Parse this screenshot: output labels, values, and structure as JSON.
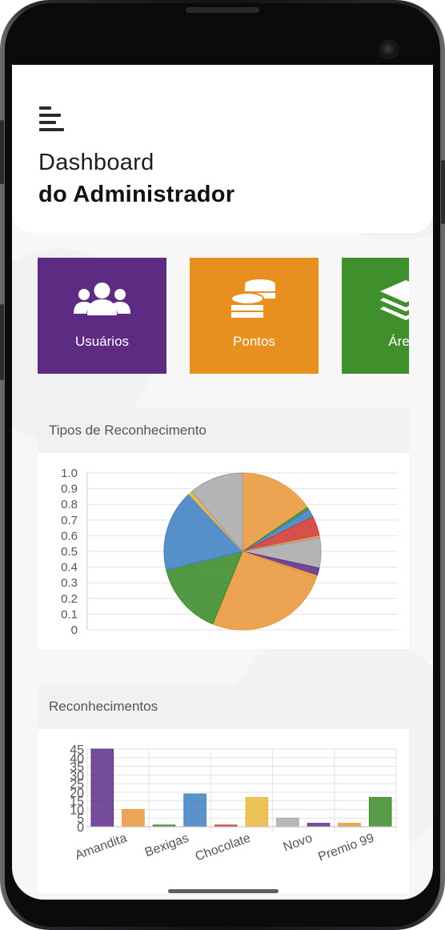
{
  "header": {
    "title_line1": "Dashboard",
    "title_line2": "do Administrador"
  },
  "tiles": [
    {
      "label": "Usuários",
      "icon": "users-icon",
      "color": "#5e2b82"
    },
    {
      "label": "Pontos",
      "icon": "coins-icon",
      "color": "#e8901f"
    },
    {
      "label": "Áreas",
      "icon": "layers-icon",
      "color": "#3f8f2c"
    }
  ],
  "pie_card": {
    "title": "Tipos de Reconhecimento"
  },
  "bar_card": {
    "title": "Reconhecimentos"
  },
  "chart_data": [
    {
      "type": "pie",
      "title": "Tipos de Reconhecimento",
      "y_ticks": [
        "1.0",
        "0.9",
        "0.8",
        "0.7",
        "0.6",
        "0.5",
        "0.4",
        "0.3",
        "0.2",
        "0.1",
        "0"
      ],
      "grid": true,
      "slices": [
        {
          "value": 0.155,
          "color": "#e9973b"
        },
        {
          "value": 0.006,
          "color": "#3b8b2a"
        },
        {
          "value": 0.016,
          "color": "#3f7fc1"
        },
        {
          "value": 0.041,
          "color": "#cf3a33"
        },
        {
          "value": 0.004,
          "color": "#e9973b"
        },
        {
          "value": 0.062,
          "color": "#aaaaaa"
        },
        {
          "value": 0.016,
          "color": "#5e2e86"
        },
        {
          "value": 0.005,
          "color": "#e9973b"
        },
        {
          "value": 0.257,
          "color": "#e9973b"
        },
        {
          "value": 0.15,
          "color": "#3b8b2a"
        },
        {
          "value": 0.168,
          "color": "#3f7fc1"
        },
        {
          "value": 0.008,
          "color": "#e3b33b"
        },
        {
          "value": 0.112,
          "color": "#aaaaaa"
        }
      ]
    },
    {
      "type": "bar",
      "title": "Reconhecimentos",
      "x_tick_labels": [
        "Amandita",
        "Bexigas",
        "Chocolate",
        "Novo",
        "Premio 99"
      ],
      "y_ticks": [
        "45",
        "40",
        "35",
        "30",
        "25",
        "20",
        "15",
        "10",
        "5",
        "0"
      ],
      "ylim": [
        0,
        45
      ],
      "grid": true,
      "values": [
        45,
        10,
        1,
        19,
        1,
        17,
        5,
        2,
        2,
        17
      ],
      "colors": [
        "#5e2e86",
        "#e9973b",
        "#3b8b2a",
        "#3f7fc1",
        "#cf3a33",
        "#e9b83b",
        "#aaaaaa",
        "#5e2e86",
        "#e9973b",
        "#3b8b2a"
      ]
    }
  ]
}
